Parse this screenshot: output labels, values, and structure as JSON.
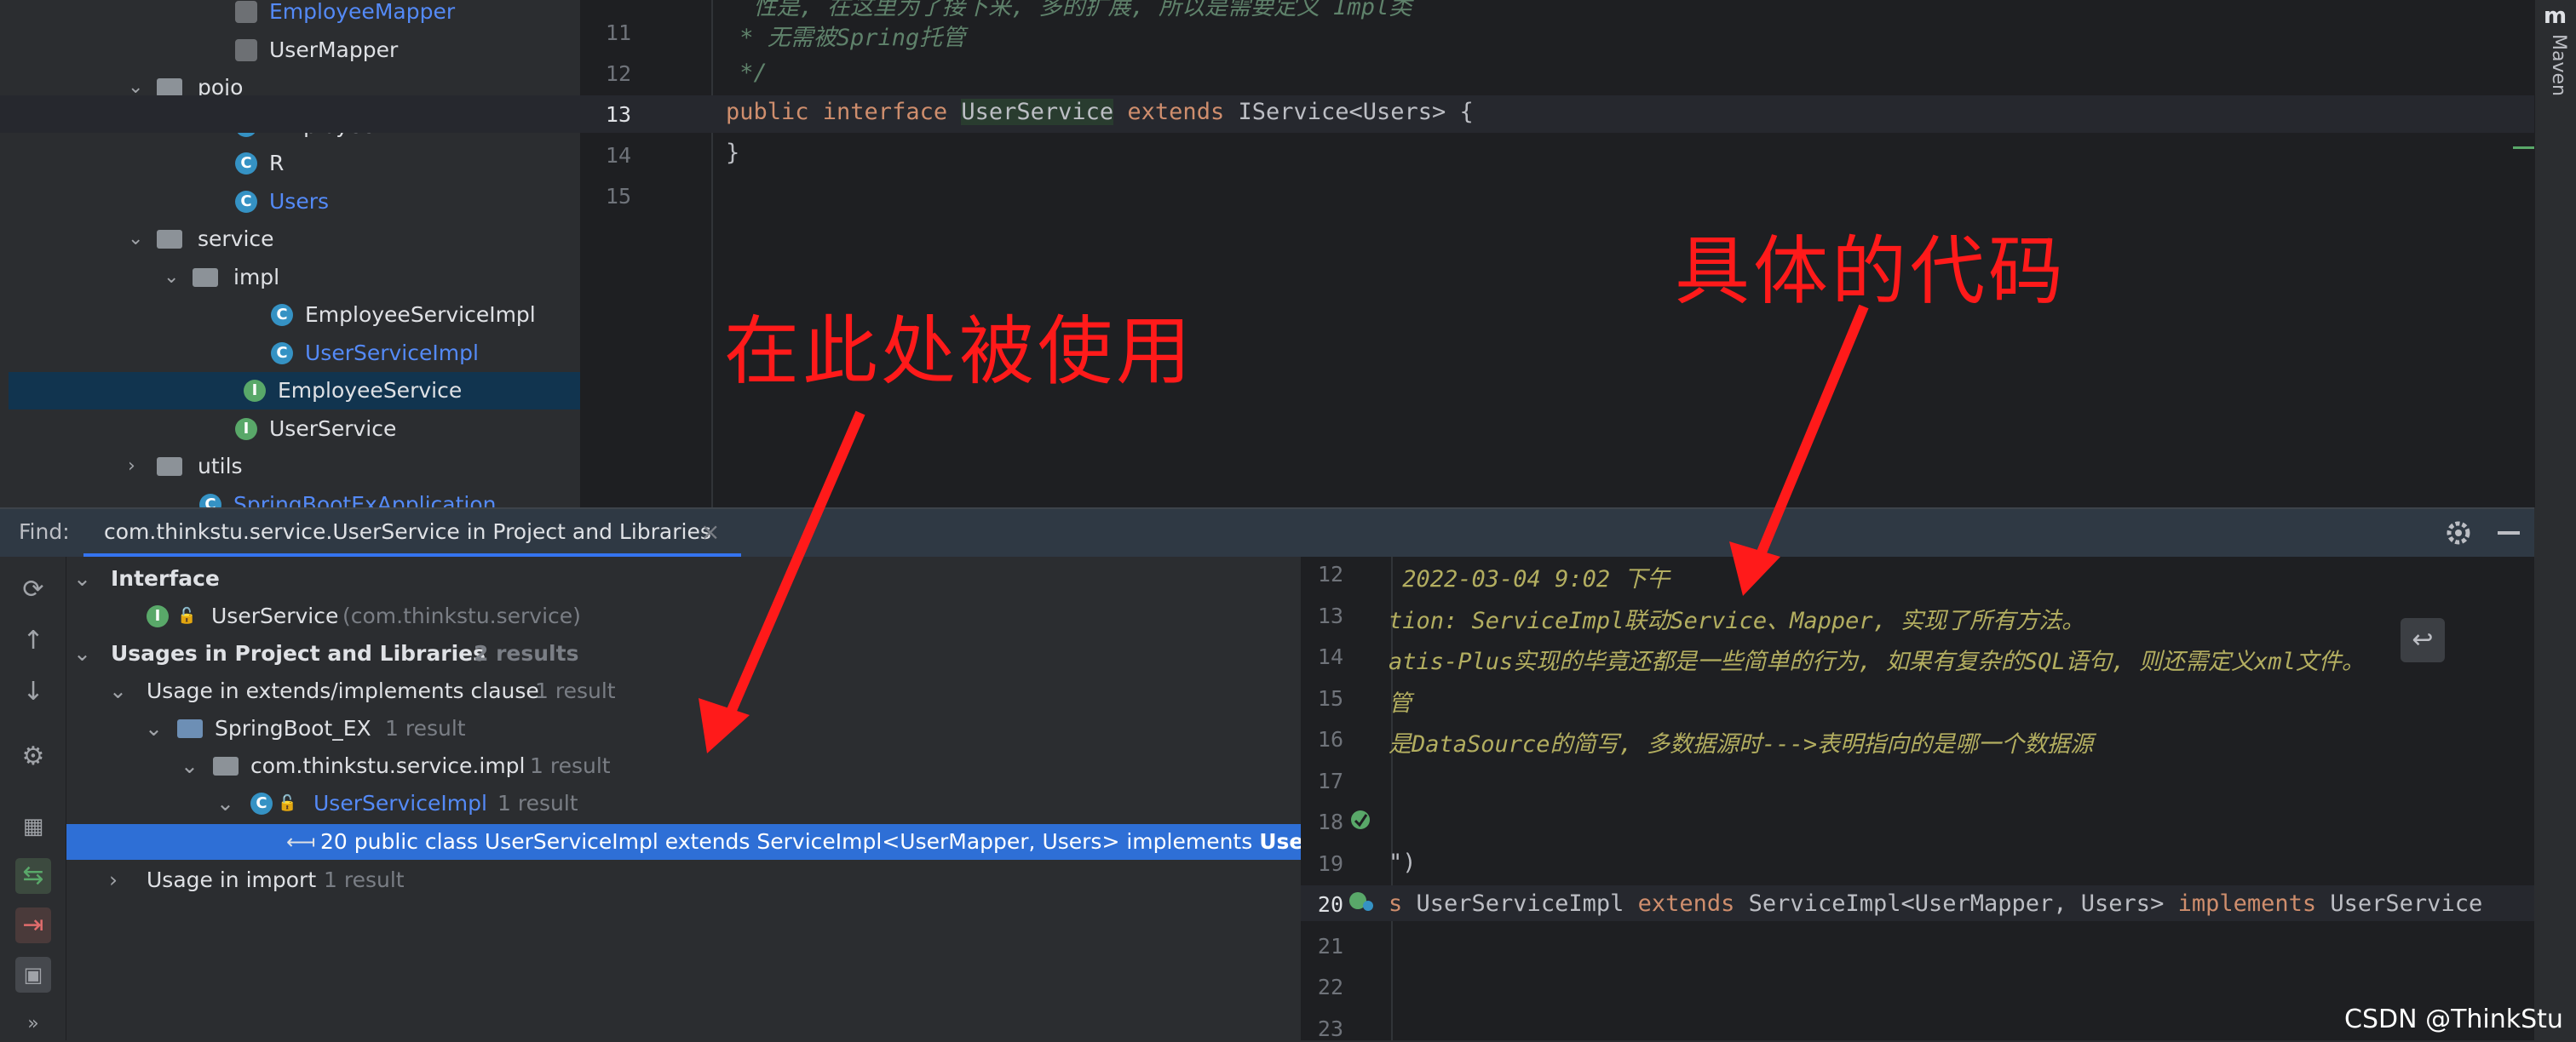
{
  "project_tree": {
    "items": [
      {
        "label": "EmployeeMapper",
        "kind": "mapper",
        "color": "#548af7"
      },
      {
        "label": "UserMapper",
        "kind": "mapper",
        "color": "#dfe1e5"
      },
      {
        "label": "pojo",
        "kind": "folder",
        "color": "#dfe1e5"
      },
      {
        "label": "Employee",
        "kind": "class",
        "color": "#dfe1e5"
      },
      {
        "label": "R",
        "kind": "class",
        "color": "#dfe1e5"
      },
      {
        "label": "Users",
        "kind": "class",
        "color": "#548af7"
      },
      {
        "label": "service",
        "kind": "folder",
        "color": "#dfe1e5"
      },
      {
        "label": "impl",
        "kind": "folder",
        "color": "#dfe1e5"
      },
      {
        "label": "EmployeeServiceImpl",
        "kind": "class",
        "color": "#dfe1e5"
      },
      {
        "label": "UserServiceImpl",
        "kind": "class",
        "color": "#548af7"
      },
      {
        "label": "EmployeeService",
        "kind": "interface",
        "color": "#dfe1e5",
        "selected": true
      },
      {
        "label": "UserService",
        "kind": "interface",
        "color": "#dfe1e5"
      },
      {
        "label": "utils",
        "kind": "folder",
        "color": "#dfe1e5"
      },
      {
        "label": "SpringBootExApplication",
        "kind": "app",
        "color": "#548af7"
      }
    ]
  },
  "editor": {
    "lines": [
      {
        "num": "11",
        "text": " * 无需被Spring托管"
      },
      {
        "num": "12",
        "text": " */"
      },
      {
        "num": "13",
        "kw1": "public interface ",
        "name": "UserService",
        "kw2": " extends ",
        "rest": "IService<Users> {"
      },
      {
        "num": "14",
        "text": "}"
      },
      {
        "num": "15",
        "text": ""
      }
    ],
    "top_partial": "  性是, 在这里为了接下来, 多的扩展, 所以是需要定义 Impl类"
  },
  "maven_label": "Maven",
  "find": {
    "label": "Find:",
    "tab": "com.thinkstu.service.UserService in Project and Libraries",
    "tab_close": "×"
  },
  "results": {
    "interface_header": "Interface",
    "interface_item": "UserService",
    "interface_pkg": "(com.thinkstu.service)",
    "usages_header": "Usages in Project and Libraries",
    "usages_count": "2 results",
    "usage_extends": "Usage in extends/implements clause",
    "usage_extends_count": "1 result",
    "module": "SpringBoot_EX",
    "module_count": "1 result",
    "package": "com.thinkstu.service.impl",
    "package_count": "1 result",
    "class": "UserServiceImpl",
    "class_count": "1 result",
    "match_line": "20 public class UserServiceImpl extends ServiceImpl<UserMapper, Users> implements ",
    "match_bold": "UserSer",
    "usage_import": "Usage in import",
    "usage_import_count": "1 result"
  },
  "preview": {
    "lines": [
      {
        "num": "12",
        "text": " 2022-03-04 9:02 下午"
      },
      {
        "num": "13",
        "text": "tion: ServiceImpl联动Service、Mapper, 实现了所有方法。"
      },
      {
        "num": "14",
        "text": "atis-Plus实现的毕竟还都是一些简单的行为, 如果有复杂的SQL语句, 则还需定义xml文件。"
      },
      {
        "num": "15",
        "text": "管"
      },
      {
        "num": "16",
        "text": "是DataSource的简写, 多数据源时--->表明指向的是哪一个数据源"
      },
      {
        "num": "17",
        "text": ""
      },
      {
        "num": "18",
        "text": ""
      },
      {
        "num": "19",
        "text": "\")"
      },
      {
        "num": "20",
        "text": "s UserServiceImpl extends ServiceImpl<UserMapper, Users> implements UserService"
      },
      {
        "num": "21",
        "text": ""
      },
      {
        "num": "22",
        "text": ""
      },
      {
        "num": "23",
        "text": ""
      }
    ]
  },
  "annotations": {
    "used_here": "在此处被使用",
    "concrete_code": "具体的代码"
  },
  "watermark": "CSDN @ThinkStu"
}
